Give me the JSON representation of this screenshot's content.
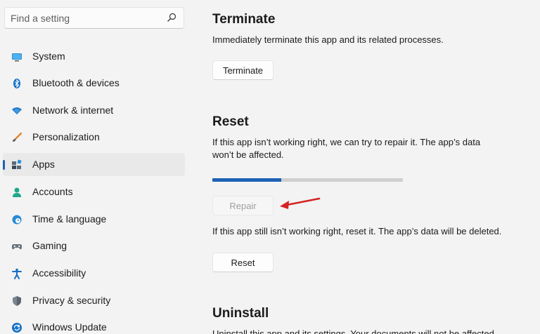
{
  "search": {
    "placeholder": "Find a setting",
    "icon": "search-icon"
  },
  "sidebar": {
    "active_index": 4,
    "accent_color": "#1d61b5",
    "items": [
      {
        "label": "System",
        "icon": "display-icon"
      },
      {
        "label": "Bluetooth & devices",
        "icon": "bluetooth-icon"
      },
      {
        "label": "Network & internet",
        "icon": "wifi-icon"
      },
      {
        "label": "Personalization",
        "icon": "brush-icon"
      },
      {
        "label": "Apps",
        "icon": "apps-icon"
      },
      {
        "label": "Accounts",
        "icon": "person-icon"
      },
      {
        "label": "Time & language",
        "icon": "globe-clock-icon"
      },
      {
        "label": "Gaming",
        "icon": "gamepad-icon"
      },
      {
        "label": "Accessibility",
        "icon": "accessibility-icon"
      },
      {
        "label": "Privacy & security",
        "icon": "shield-icon"
      },
      {
        "label": "Windows Update",
        "icon": "update-icon"
      }
    ]
  },
  "main": {
    "terminate": {
      "title": "Terminate",
      "description": "Immediately terminate this app and its related processes.",
      "button": "Terminate"
    },
    "reset": {
      "title": "Reset",
      "repair_description_line1": "If this app isn’t working right, we can try to repair it. The app’s data",
      "repair_description_line2": "won’t be affected.",
      "repair_progress": 0.36,
      "repair_button": "Repair",
      "reset_description": "If this app still isn’t working right, reset it. The app’s data will be deleted.",
      "reset_button": "Reset"
    },
    "uninstall": {
      "title": "Uninstall",
      "description": "Uninstall this app and its settings. Your documents will not be affected."
    }
  }
}
